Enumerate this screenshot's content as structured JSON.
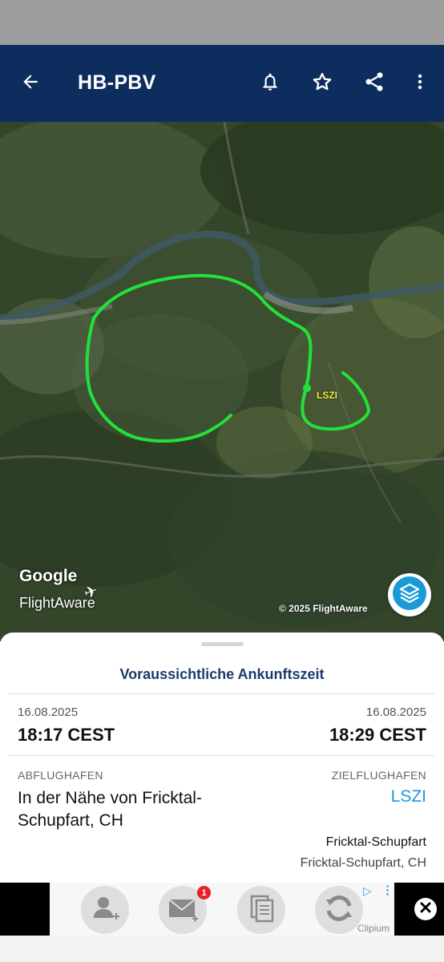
{
  "appbar": {
    "title": "HB-PBV",
    "back_icon": "arrow-left-icon",
    "bell_icon": "bell-icon",
    "star_icon": "star-icon",
    "share_icon": "share-icon",
    "menu_icon": "more-vertical-icon"
  },
  "map": {
    "google_label": "Google",
    "flightaware_label": "FlightAware",
    "copyright": "© 2025 FlightAware",
    "airport_label": "LSZI",
    "track_color": "#22e23a",
    "layers_icon": "layers-icon"
  },
  "sheet": {
    "eta_title": "Voraussichtliche Ankunftszeit",
    "departure": {
      "date": "16.08.2025",
      "time": "18:17 CEST"
    },
    "arrival": {
      "date": "16.08.2025",
      "time": "18:29 CEST"
    },
    "origin_label": "ABFLUGHAFEN",
    "origin_value": "In der Nähe von Fricktal-Schupfart, CH",
    "destination_label": "ZIELFLUGHAFEN",
    "destination_code": "LSZI",
    "destination_city": "Fricktal-Schupfart",
    "destination_region": "Fricktal-Schupfart, CH"
  },
  "ad": {
    "badge_count": "1",
    "brand": "Clipium",
    "icons": [
      "add-contact-icon",
      "add-mail-icon",
      "clipboard-icon",
      "refresh-icon"
    ],
    "close_icon": "close-icon",
    "adchoices_icon": "adchoices-icon"
  }
}
